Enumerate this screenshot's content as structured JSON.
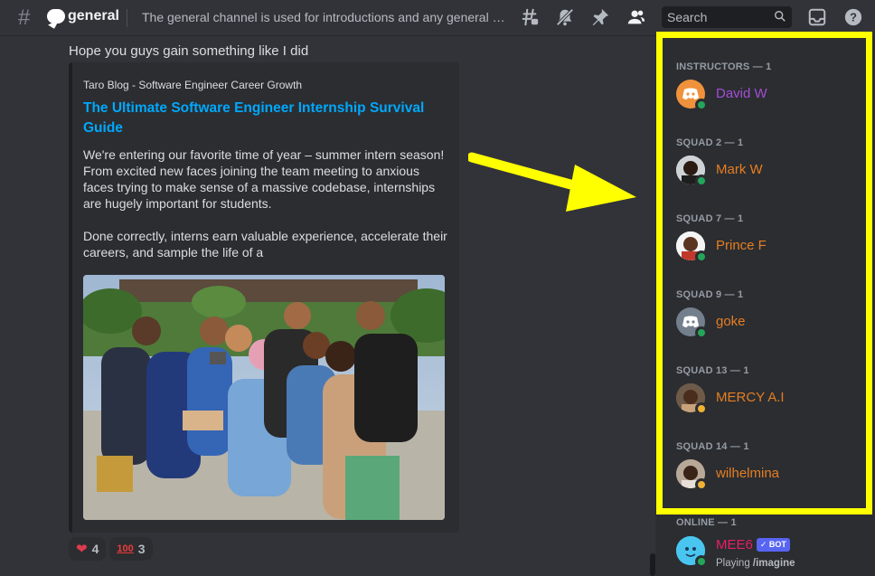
{
  "header": {
    "channel_name": "general",
    "topic": "The general channel is used for introductions and any general disc..."
  },
  "icons": {
    "threads": "threads-icon",
    "mute": "notification-bell-muted-icon",
    "pin": "pin-icon",
    "members": "member-list-icon",
    "inbox": "inbox-icon",
    "help": "help-icon"
  },
  "search": {
    "placeholder": "Search"
  },
  "message": {
    "text": "Hope you guys gain something like I did",
    "embed": {
      "provider": "Taro Blog - Software Engineer Career Growth",
      "title": "The Ultimate Software Engineer Internship Survival Guide",
      "description": "We're entering our favorite time of year – summer intern season! From excited new faces joining the team meeting to anxious faces trying to make sense of a massive codebase, internships are hugely important for students.\n\nDone correctly, interns earn valuable experience, accelerate their careers, and sample the life of a",
      "title_color": "#00a8fc"
    },
    "reactions": [
      {
        "emoji": "❤",
        "count": "4"
      },
      {
        "emoji": "100",
        "count": "3"
      }
    ]
  },
  "members": {
    "groups": [
      {
        "label": "INSTRUCTORS — 1",
        "member": {
          "name": "David W",
          "color": "#a34ed6",
          "status": "online",
          "avatar": "discord-logo-orange"
        }
      },
      {
        "label": "SQUAD 2 — 1",
        "member": {
          "name": "Mark W",
          "color": "#e67e22",
          "status": "online",
          "avatar": "photo"
        }
      },
      {
        "label": "SQUAD 7 — 1",
        "member": {
          "name": "Prince F",
          "color": "#e67e22",
          "status": "online",
          "avatar": "photo"
        }
      },
      {
        "label": "SQUAD 9 — 1",
        "member": {
          "name": "goke",
          "color": "#e67e22",
          "status": "online",
          "avatar": "discord-logo-gray"
        }
      },
      {
        "label": "SQUAD 13 — 1",
        "member": {
          "name": "MERCY A.I",
          "color": "#e67e22",
          "status": "idle",
          "avatar": "photo"
        }
      },
      {
        "label": "SQUAD 14 — 1",
        "member": {
          "name": "wilhelmina",
          "color": "#e67e22",
          "status": "idle",
          "avatar": "photo"
        }
      },
      {
        "label": "ONLINE — 1",
        "member": {
          "name": "MEE6",
          "color": "#e91e63",
          "status": "online",
          "avatar": "mee6-bot",
          "badge": "BOT",
          "activity_prefix": "Playing",
          "activity": "/imagine"
        }
      }
    ]
  },
  "colors": {
    "highlight_box": "#ffff00",
    "arrow": "#ffff00"
  }
}
